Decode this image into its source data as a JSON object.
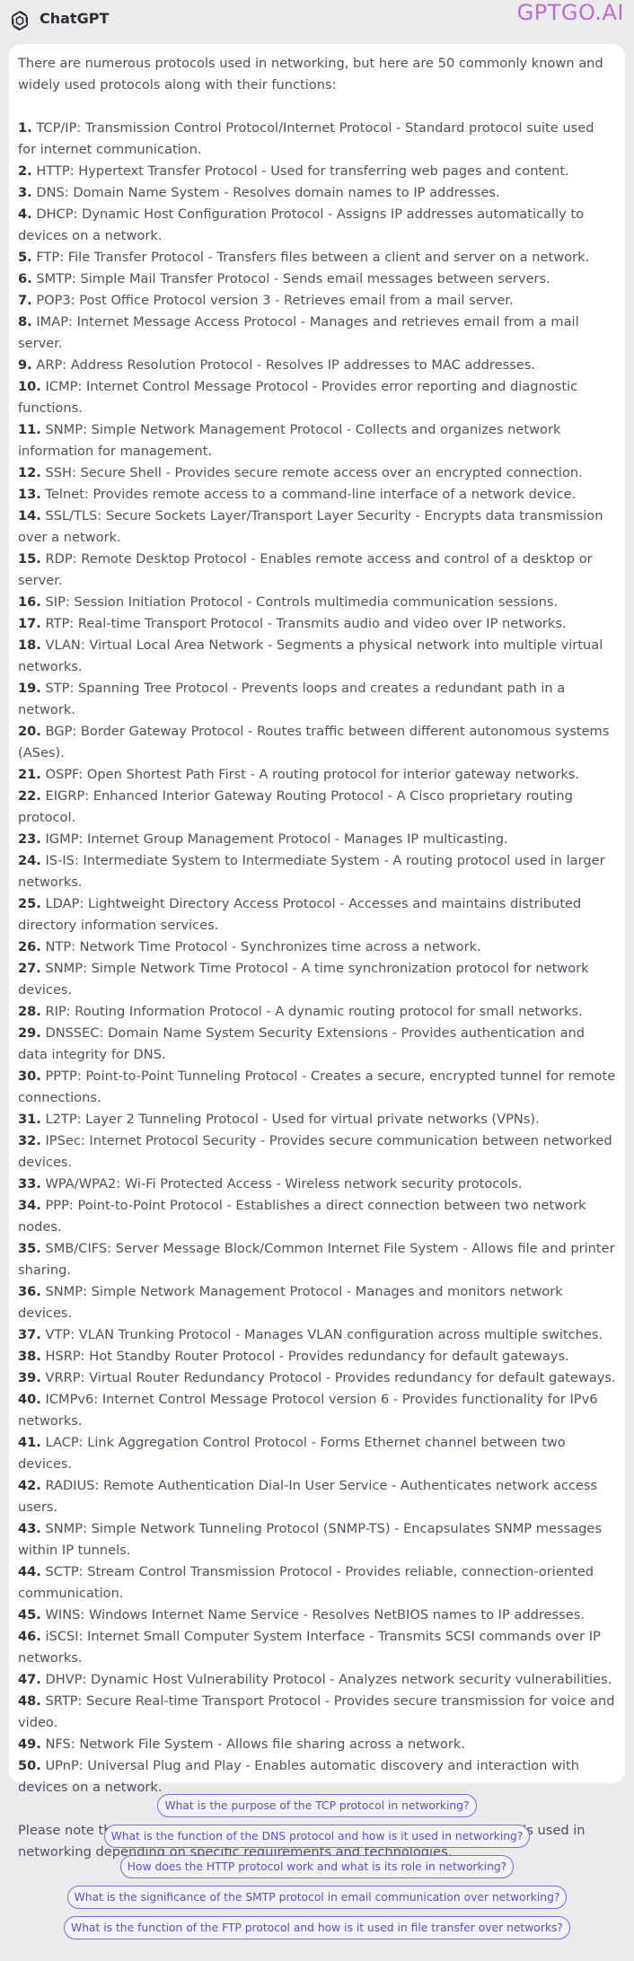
{
  "header": {
    "app_title": "ChatGPT",
    "brand": "GPTGO.AI"
  },
  "message": {
    "intro": "There are numerous protocols used in networking, but here are 50 commonly known and widely used protocols along with their functions:",
    "items": [
      {
        "num": "1.",
        "text": "TCP/IP: Transmission Control Protocol/Internet Protocol - Standard protocol suite used for internet communication."
      },
      {
        "num": "2.",
        "text": "HTTP: Hypertext Transfer Protocol - Used for transferring web pages and content."
      },
      {
        "num": "3.",
        "text": "DNS: Domain Name System - Resolves domain names to IP addresses."
      },
      {
        "num": "4.",
        "text": "DHCP: Dynamic Host Configuration Protocol - Assigns IP addresses automatically to devices on a network."
      },
      {
        "num": "5.",
        "text": "FTP: File Transfer Protocol - Transfers files between a client and server on a network."
      },
      {
        "num": "6.",
        "text": "SMTP: Simple Mail Transfer Protocol - Sends email messages between servers."
      },
      {
        "num": "7.",
        "text": "POP3: Post Office Protocol version 3 - Retrieves email from a mail server."
      },
      {
        "num": "8.",
        "text": "IMAP: Internet Message Access Protocol - Manages and retrieves email from a mail server."
      },
      {
        "num": "9.",
        "text": "ARP: Address Resolution Protocol - Resolves IP addresses to MAC addresses."
      },
      {
        "num": "10.",
        "text": "ICMP: Internet Control Message Protocol - Provides error reporting and diagnostic functions."
      },
      {
        "num": "11.",
        "text": "SNMP: Simple Network Management Protocol - Collects and organizes network information for management."
      },
      {
        "num": "12.",
        "text": "SSH: Secure Shell - Provides secure remote access over an encrypted connection."
      },
      {
        "num": "13.",
        "text": "Telnet: Provides remote access to a command-line interface of a network device."
      },
      {
        "num": "14.",
        "text": "SSL/TLS: Secure Sockets Layer/Transport Layer Security - Encrypts data transmission over a network."
      },
      {
        "num": "15.",
        "text": "RDP: Remote Desktop Protocol - Enables remote access and control of a desktop or server."
      },
      {
        "num": "16.",
        "text": "SIP: Session Initiation Protocol - Controls multimedia communication sessions."
      },
      {
        "num": "17.",
        "text": "RTP: Real-time Transport Protocol - Transmits audio and video over IP networks."
      },
      {
        "num": "18.",
        "text": "VLAN: Virtual Local Area Network - Segments a physical network into multiple virtual networks."
      },
      {
        "num": "19.",
        "text": "STP: Spanning Tree Protocol - Prevents loops and creates a redundant path in a network."
      },
      {
        "num": "20.",
        "text": "BGP: Border Gateway Protocol - Routes traffic between different autonomous systems (ASes)."
      },
      {
        "num": "21.",
        "text": "OSPF: Open Shortest Path First - A routing protocol for interior gateway networks."
      },
      {
        "num": "22.",
        "text": "EIGRP: Enhanced Interior Gateway Routing Protocol - A Cisco proprietary routing protocol."
      },
      {
        "num": "23.",
        "text": "IGMP: Internet Group Management Protocol - Manages IP multicasting."
      },
      {
        "num": "24.",
        "text": "IS-IS: Intermediate System to Intermediate System - A routing protocol used in larger networks."
      },
      {
        "num": "25.",
        "text": "LDAP: Lightweight Directory Access Protocol - Accesses and maintains distributed directory information services."
      },
      {
        "num": "26.",
        "text": "NTP: Network Time Protocol - Synchronizes time across a network."
      },
      {
        "num": "27.",
        "text": "SNMP: Simple Network Time Protocol - A time synchronization protocol for network devices."
      },
      {
        "num": "28.",
        "text": "RIP: Routing Information Protocol - A dynamic routing protocol for small networks."
      },
      {
        "num": "29.",
        "text": "DNSSEC: Domain Name System Security Extensions - Provides authentication and data integrity for DNS."
      },
      {
        "num": "30.",
        "text": "PPTP: Point-to-Point Tunneling Protocol - Creates a secure, encrypted tunnel for remote connections."
      },
      {
        "num": "31.",
        "text": "L2TP: Layer 2 Tunneling Protocol - Used for virtual private networks (VPNs)."
      },
      {
        "num": "32.",
        "text": "IPSec: Internet Protocol Security - Provides secure communication between networked devices."
      },
      {
        "num": "33.",
        "text": "WPA/WPA2: Wi-Fi Protected Access - Wireless network security protocols."
      },
      {
        "num": "34.",
        "text": "PPP: Point-to-Point Protocol - Establishes a direct connection between two network nodes."
      },
      {
        "num": "35.",
        "text": "SMB/CIFS: Server Message Block/Common Internet File System - Allows file and printer sharing."
      },
      {
        "num": "36.",
        "text": "SNMP: Simple Network Management Protocol - Manages and monitors network devices."
      },
      {
        "num": "37.",
        "text": "VTP: VLAN Trunking Protocol - Manages VLAN configuration across multiple switches."
      },
      {
        "num": "38.",
        "text": "HSRP: Hot Standby Router Protocol - Provides redundancy for default gateways."
      },
      {
        "num": "39.",
        "text": "VRRP: Virtual Router Redundancy Protocol - Provides redundancy for default gateways."
      },
      {
        "num": "40.",
        "text": "ICMPv6: Internet Control Message Protocol version 6 - Provides functionality for IPv6 networks."
      },
      {
        "num": "41.",
        "text": "LACP: Link Aggregation Control Protocol - Forms Ethernet channel between two devices."
      },
      {
        "num": "42.",
        "text": "RADIUS: Remote Authentication Dial-In User Service - Authenticates network access users."
      },
      {
        "num": "43.",
        "text": "SNMP: Simple Network Tunneling Protocol (SNMP-TS) - Encapsulates SNMP messages within IP tunnels."
      },
      {
        "num": "44.",
        "text": "SCTP: Stream Control Transmission Protocol - Provides reliable, connection-oriented communication."
      },
      {
        "num": "45.",
        "text": "WINS: Windows Internet Name Service - Resolves NetBIOS names to IP addresses."
      },
      {
        "num": "46.",
        "text": "iSCSI: Internet Small Computer System Interface - Transmits SCSI commands over IP networks."
      },
      {
        "num": "47.",
        "text": "DHVP: Dynamic Host Vulnerability Protocol - Analyzes network security vulnerabilities."
      },
      {
        "num": "48.",
        "text": "SRTP: Secure Real-time Transport Protocol - Provides secure transmission for voice and video."
      },
      {
        "num": "49.",
        "text": "NFS: Network File System - Allows file sharing across a network."
      },
      {
        "num": "50.",
        "text": "UPnP: Universal Plug and Play - Enables automatic discovery and interaction with devices on a network."
      }
    ],
    "outro": "Please note that this list is not exhaustive, and there are many more protocols used in networking depending on specific requirements and technologies."
  },
  "suggestions": [
    "What is the purpose of the TCP protocol in networking?",
    "What is the function of the DNS protocol and how is it used in networking?",
    "How does the HTTP protocol work and what is its role in networking?",
    "What is the significance of the SMTP protocol in email communication over networking?",
    "What is the function of the FTP protocol and how is it used in file transfer over networks?"
  ],
  "colors": {
    "brand": "#b86fd0",
    "suggestion_border": "#7b6fd8",
    "background": "#ebebed"
  },
  "icons": {
    "logo": "openai-logo-icon"
  }
}
